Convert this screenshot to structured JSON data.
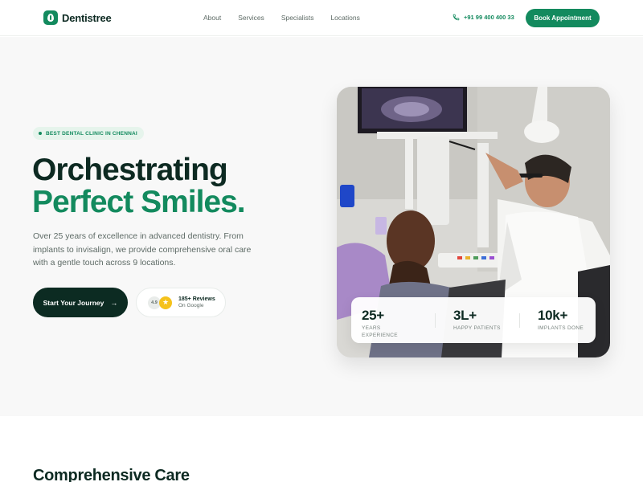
{
  "header": {
    "logo_text": "Dentistree",
    "nav": [
      "About",
      "Services",
      "Specialists",
      "Locations"
    ],
    "phone": "+91 99 400 400 33",
    "cta": "Book Appointment"
  },
  "hero": {
    "badge": "BEST DENTAL CLINIC IN CHENNAI",
    "headline_line1": "Orchestrating",
    "headline_line2": "Perfect Smiles.",
    "description": "Over 25 years of excellence in advanced dentistry. From implants to invisalign, we provide comprehensive oral care with a gentle touch across 9 locations.",
    "primary_cta": "Start Your Journey",
    "primary_cta_icon": "→",
    "reviews": {
      "rating": "4.9",
      "star_icon": "★",
      "count": "185+ Reviews",
      "source": "On Google"
    }
  },
  "stats": [
    {
      "value": "25+",
      "label": "YEARS EXPERIENCE"
    },
    {
      "value": "3L+",
      "label": "HAPPY PATIENTS"
    },
    {
      "value": "10k+",
      "label": "IMPLANTS DONE"
    }
  ],
  "section": {
    "title": "Comprehensive Care"
  },
  "colors": {
    "brand_green": "#138a5e",
    "dark_green": "#0c2b22",
    "hero_bg": "#f8f8f8",
    "star": "#f5c21b"
  },
  "icons": {
    "logo": "leaf-icon",
    "phone": "phone-icon",
    "star": "star-icon",
    "arrow": "arrow-right-icon"
  }
}
